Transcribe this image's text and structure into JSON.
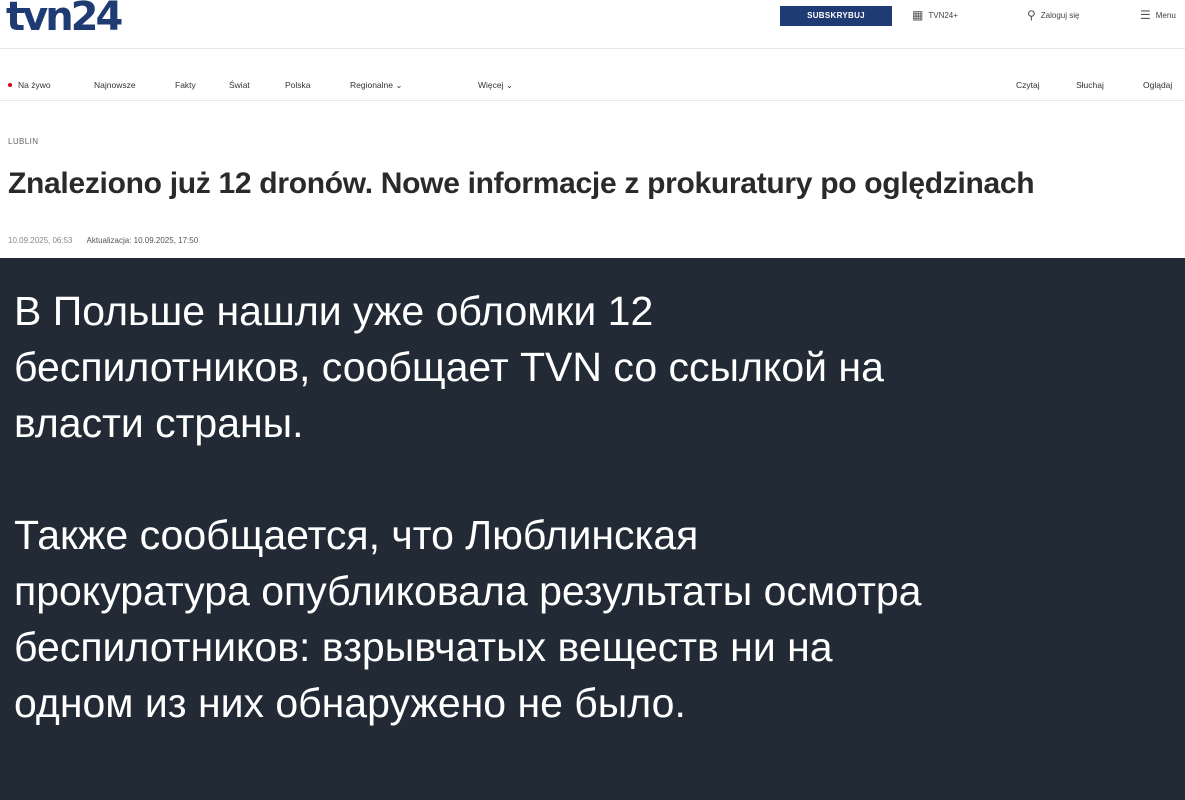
{
  "site": {
    "logo": "tvn24",
    "subscribe_label": "SUBSKRYBUJ",
    "tvn24plus_label": "TVN24+",
    "login_label": "Zaloguj się",
    "menu_label": "Menu"
  },
  "nav": {
    "items": [
      "Na żywo",
      "Najnowsze",
      "Fakty",
      "Świat",
      "Polska",
      "Regionalne ⌄",
      "Więcej ⌄"
    ],
    "right": [
      "Czytaj",
      "Słuchaj",
      "Oglądaj"
    ]
  },
  "article": {
    "category": "LUBLIN",
    "headline": "Znaleziono już 12 dronów. Nowe informacje z prokuratury po oględzinach",
    "published": "10.09.2025, 06:53",
    "updated": "Aktualizacja: 10.09.2025, 17:50"
  },
  "post": {
    "paragraph1_lines": [
      "В Польше нашли уже обломки 12",
      "беспилотников, сообщает TVN со ссылкой на",
      "власти страны."
    ],
    "paragraph2_lines": [
      "Также сообщается, что Люблинская",
      "прокуратура опубликовала результаты осмотра",
      "беспилотников: взрывчатых веществ ни на",
      "одном из них обнаружено не было."
    ]
  }
}
